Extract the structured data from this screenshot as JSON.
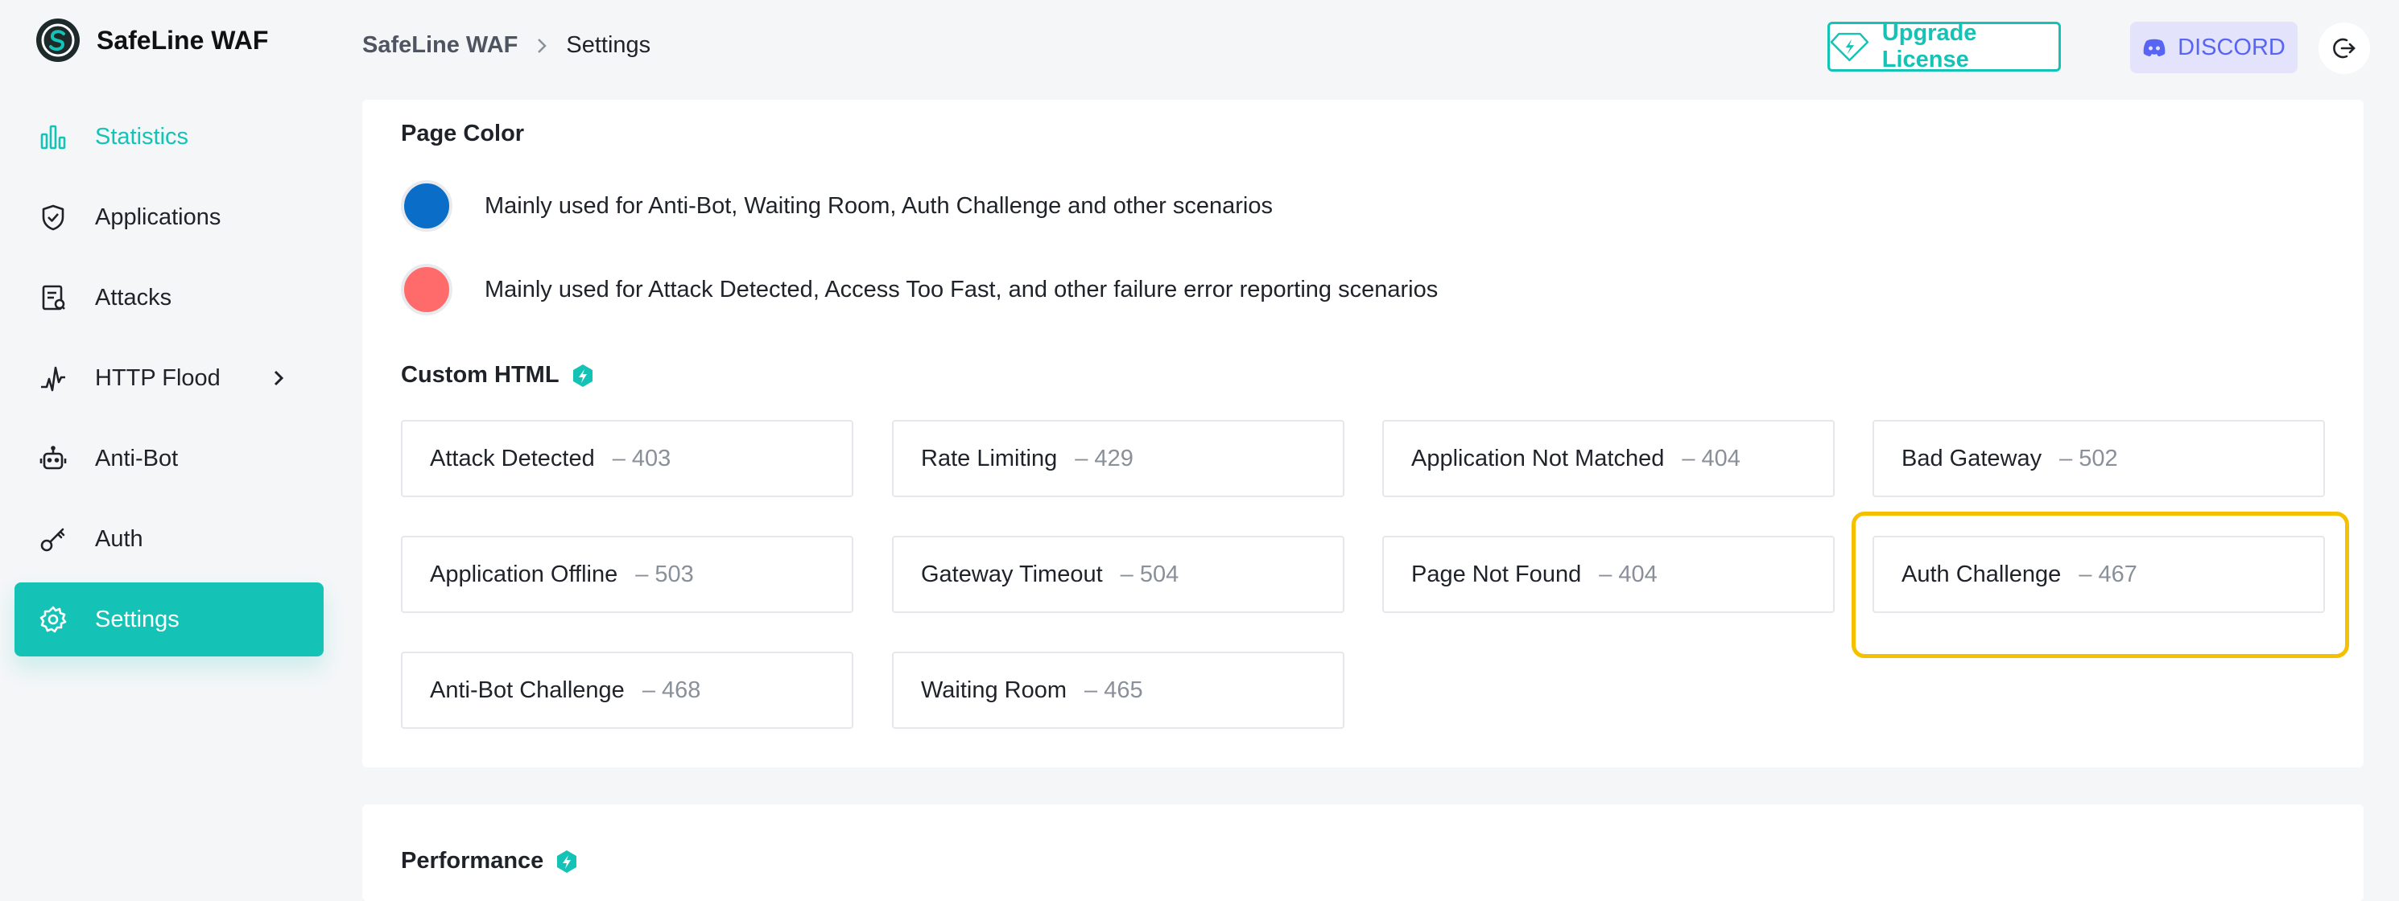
{
  "app": {
    "name": "SafeLine WAF"
  },
  "header": {
    "breadcrumb": [
      "SafeLine WAF",
      "Settings"
    ],
    "upgrade_label": "Upgrade License",
    "discord_label": "DISCORD"
  },
  "sidebar": {
    "items": [
      {
        "label": "Statistics",
        "icon": "bar-chart-icon"
      },
      {
        "label": "Applications",
        "icon": "shield-icon"
      },
      {
        "label": "Attacks",
        "icon": "report-icon"
      },
      {
        "label": "HTTP Flood",
        "icon": "pulse-icon"
      },
      {
        "label": "Anti-Bot",
        "icon": "robot-icon"
      },
      {
        "label": "Auth",
        "icon": "key-icon"
      },
      {
        "label": "Settings",
        "icon": "gear-icon"
      }
    ],
    "active": "Settings"
  },
  "page_color": {
    "title": "Page Color",
    "colors": [
      {
        "hex": "#0a6ec8",
        "description": "Mainly used for Anti-Bot, Waiting Room, Auth Challenge and other scenarios"
      },
      {
        "hex": "#ff6b6b",
        "description": "Mainly used for Attack Detected, Access Too Fast, and other failure error reporting scenarios"
      }
    ]
  },
  "custom_html": {
    "title": "Custom HTML",
    "pages": [
      {
        "name": "Attack Detected",
        "code": "– 403"
      },
      {
        "name": "Rate Limiting",
        "code": "– 429"
      },
      {
        "name": "Application Not Matched",
        "code": "– 404"
      },
      {
        "name": "Bad Gateway",
        "code": "– 502"
      },
      {
        "name": "Application Offline",
        "code": "– 503"
      },
      {
        "name": "Gateway Timeout",
        "code": "– 504"
      },
      {
        "name": "Page Not Found",
        "code": "– 404"
      },
      {
        "name": "Auth Challenge",
        "code": "– 467"
      },
      {
        "name": "Anti-Bot Challenge",
        "code": "– 468"
      },
      {
        "name": "Waiting Room",
        "code": "– 465"
      }
    ],
    "highlighted": "Auth Challenge"
  },
  "performance": {
    "title": "Performance"
  },
  "colors": {
    "accent": "#14c3b6",
    "highlight": "#f5c000",
    "discord": "#5865f2"
  }
}
